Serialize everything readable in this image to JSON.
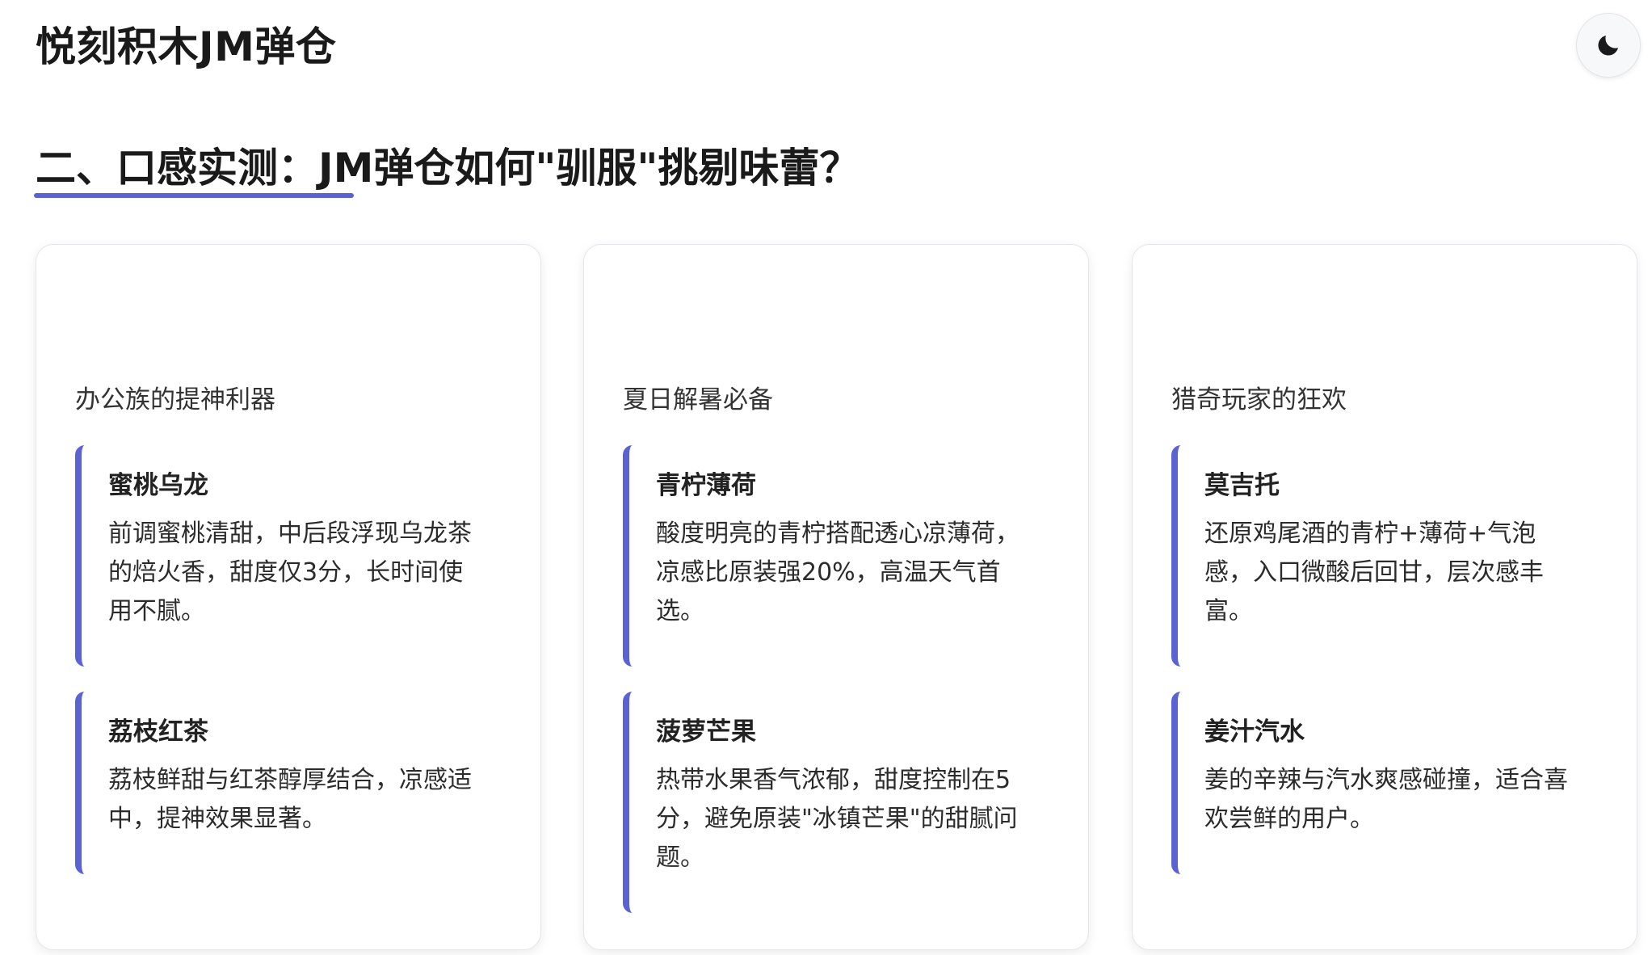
{
  "header": {
    "site_title": "悦刻积木JM弹仓",
    "theme_toggle_icon": "moon-icon"
  },
  "section": {
    "heading": "二、口感实测：JM弹仓如何\"驯服\"挑剔味蕾？",
    "accent_color": "#5b63d3"
  },
  "cards": [
    {
      "subtitle": "办公族的提神利器",
      "flavors": [
        {
          "name": "蜜桃乌龙",
          "desc": "前调蜜桃清甜，中后段浮现乌龙茶的焙火香，甜度仅3分，长时间使用不腻。"
        },
        {
          "name": "荔枝红茶",
          "desc": "荔枝鲜甜与红茶醇厚结合，凉感适中，提神效果显著。"
        }
      ]
    },
    {
      "subtitle": "夏日解暑必备",
      "flavors": [
        {
          "name": "青柠薄荷",
          "desc": "酸度明亮的青柠搭配透心凉薄荷，凉感比原装强20%，高温天气首选。"
        },
        {
          "name": "菠萝芒果",
          "desc": "热带水果香气浓郁，甜度控制在5分，避免原装\"冰镇芒果\"的甜腻问题。"
        }
      ]
    },
    {
      "subtitle": "猎奇玩家的狂欢",
      "flavors": [
        {
          "name": "莫吉托",
          "desc": "还原鸡尾酒的青柠+薄荷+气泡感，入口微酸后回甘，层次感丰富。"
        },
        {
          "name": "姜汁汽水",
          "desc": "姜的辛辣与汽水爽感碰撞，适合喜欢尝鲜的用户。"
        }
      ]
    }
  ]
}
